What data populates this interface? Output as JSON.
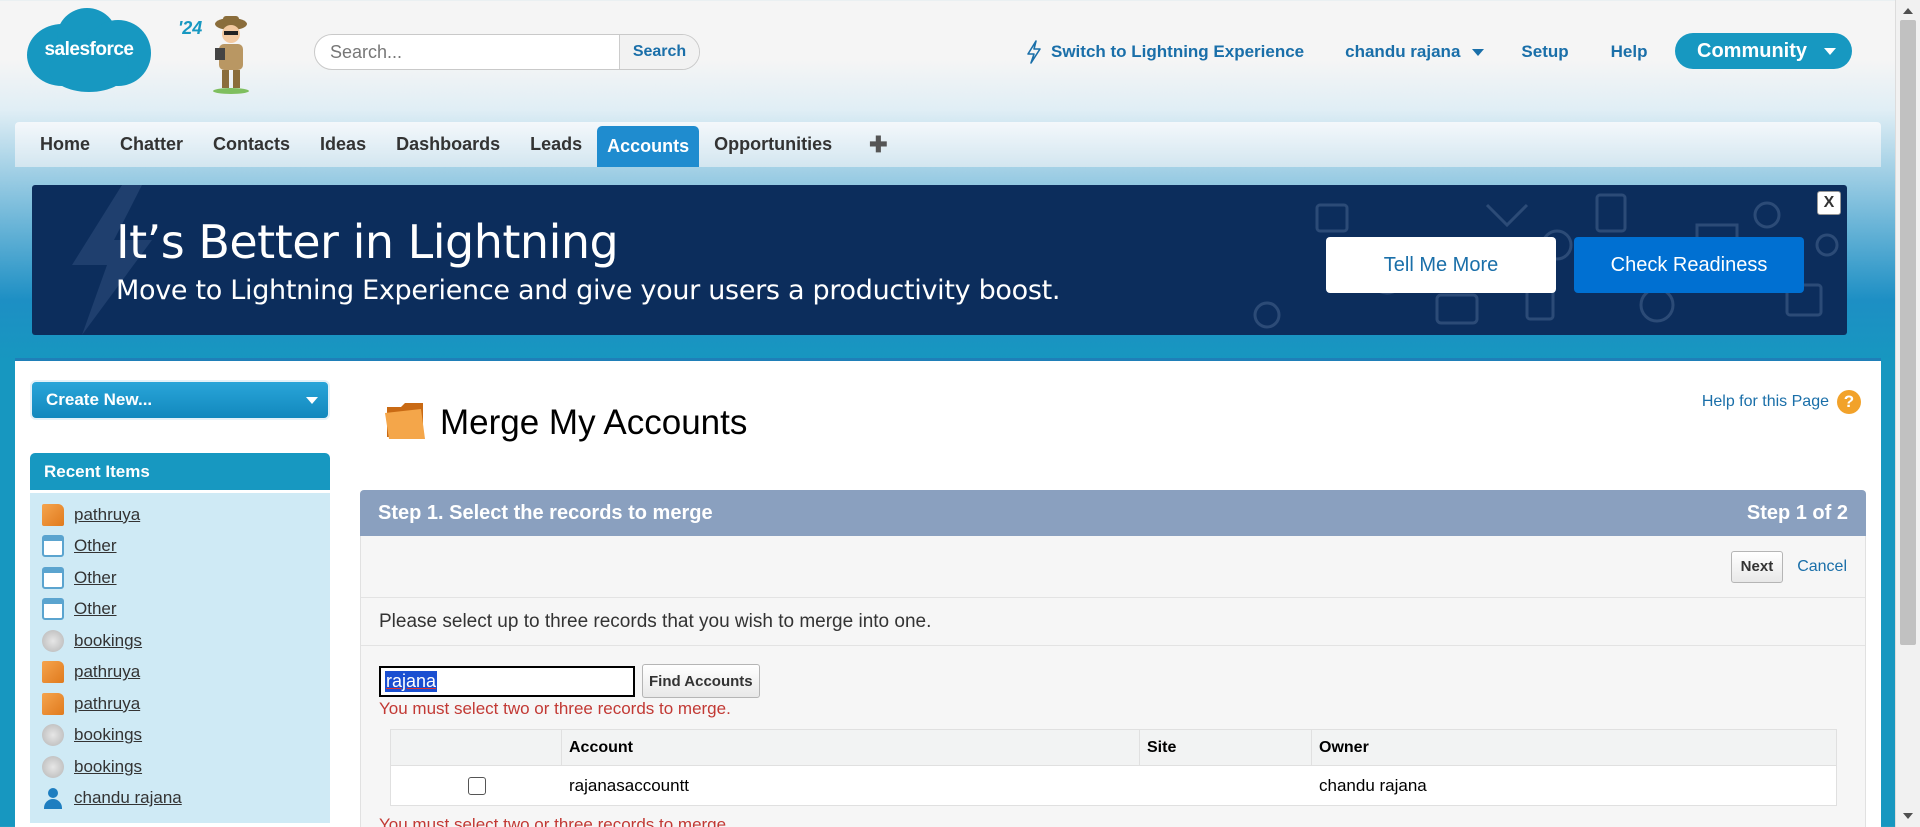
{
  "header": {
    "logo_text": "salesforce",
    "release_badge": "'24",
    "search_placeholder": "Search...",
    "search_button": "Search",
    "links": {
      "lightning": "Switch to Lightning Experience",
      "user": "chandu rajana",
      "setup": "Setup",
      "help": "Help"
    },
    "community": "Community"
  },
  "tabs": [
    {
      "label": "Home",
      "active": false
    },
    {
      "label": "Chatter",
      "active": false
    },
    {
      "label": "Contacts",
      "active": false
    },
    {
      "label": "Ideas",
      "active": false
    },
    {
      "label": "Dashboards",
      "active": false
    },
    {
      "label": "Leads",
      "active": false
    },
    {
      "label": "Accounts",
      "active": true
    },
    {
      "label": "Opportunities",
      "active": false
    },
    {
      "label": "✚",
      "active": false
    }
  ],
  "banner": {
    "title": "It’s Better in Lightning",
    "subtitle": "Move to Lightning Experience and give your users a productivity boost.",
    "tell_me_more": "Tell Me More",
    "check_readiness": "Check Readiness",
    "close": "X"
  },
  "sidebar": {
    "create_new": "Create New...",
    "recent_title": "Recent Items",
    "recent_items": [
      {
        "label": "pathruya",
        "icon": "account-icon"
      },
      {
        "label": "Other",
        "icon": "calendar-icon"
      },
      {
        "label": "Other",
        "icon": "calendar-icon"
      },
      {
        "label": "Other",
        "icon": "calendar-icon"
      },
      {
        "label": "bookings",
        "icon": "booking-icon"
      },
      {
        "label": "pathruya",
        "icon": "account-icon"
      },
      {
        "label": "pathruya",
        "icon": "account-icon"
      },
      {
        "label": "bookings",
        "icon": "booking-icon"
      },
      {
        "label": "bookings",
        "icon": "booking-icon"
      },
      {
        "label": "chandu rajana",
        "icon": "user-icon"
      }
    ]
  },
  "main": {
    "title": "Merge My Accounts",
    "help_link": "Help for this Page",
    "step_title": "Step 1. Select the records to merge",
    "step_count": "Step 1 of 2",
    "next_button": "Next",
    "cancel_link": "Cancel",
    "instructions": "Please select up to three records that you wish to merge into one.",
    "search_value": "rajana",
    "find_button": "Find Accounts",
    "error_message": "You must select two or three records to merge.",
    "table": {
      "headers": [
        "",
        "Account",
        "Site",
        "Owner"
      ],
      "rows": [
        {
          "account": "rajanasaccountt",
          "site": "",
          "owner": "chandu rajana",
          "checked": false
        }
      ]
    }
  },
  "colors": {
    "brand": "#1798c1",
    "active_tab": "#1f8ccf",
    "banner_bg": "#0c2d5c",
    "step_header": "#8aa0bf",
    "error": "#c23934"
  }
}
